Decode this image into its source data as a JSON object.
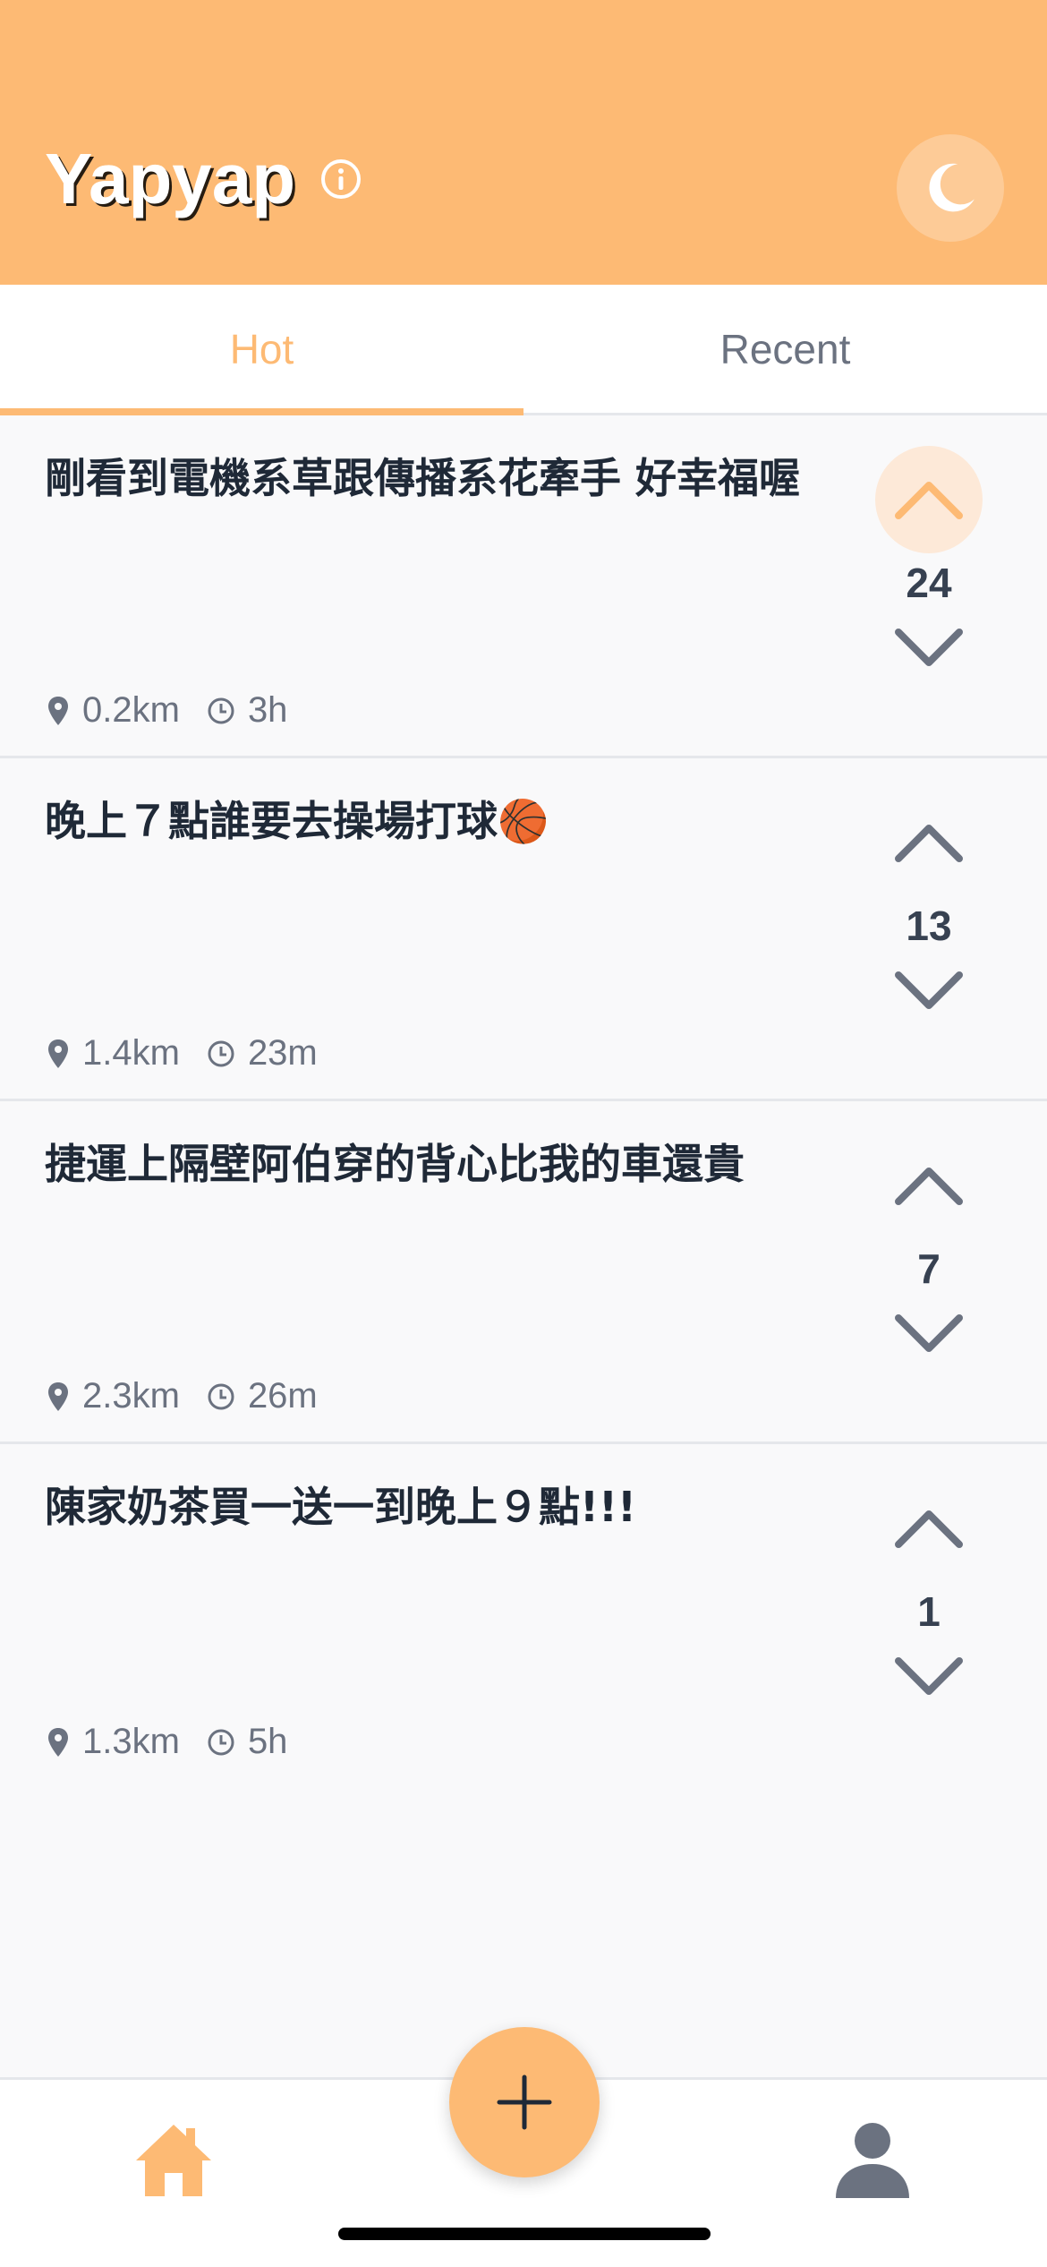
{
  "app": {
    "title": "Yapyap"
  },
  "colors": {
    "accent": "#fdba74",
    "text": "#1f2937",
    "muted": "#6b7280"
  },
  "tabs": [
    {
      "label": "Hot",
      "active": true
    },
    {
      "label": "Recent",
      "active": false
    }
  ],
  "posts": [
    {
      "text": "剛看到電機系草跟傳播系花牽手 好幸福喔",
      "distance": "0.2km",
      "time": "3h",
      "votes": "24",
      "upvoted": true
    },
    {
      "text": "晚上７點誰要去操場打球🏀",
      "distance": "1.4km",
      "time": "23m",
      "votes": "13",
      "upvoted": false
    },
    {
      "text": "捷運上隔壁阿伯穿的背心比我的車還貴",
      "distance": "2.3km",
      "time": "26m",
      "votes": "7",
      "upvoted": false
    },
    {
      "text": "陳家奶茶買一送一到晚上９點!!!",
      "distance": "1.3km",
      "time": "5h",
      "votes": "1",
      "upvoted": false
    }
  ],
  "icons": {
    "info": "info-icon",
    "theme": "moon-icon",
    "location": "map-pin-icon",
    "time": "clock-icon",
    "upvote": "chevron-up-icon",
    "downvote": "chevron-down-icon",
    "home": "home-icon",
    "add": "plus-icon",
    "profile": "user-icon"
  }
}
